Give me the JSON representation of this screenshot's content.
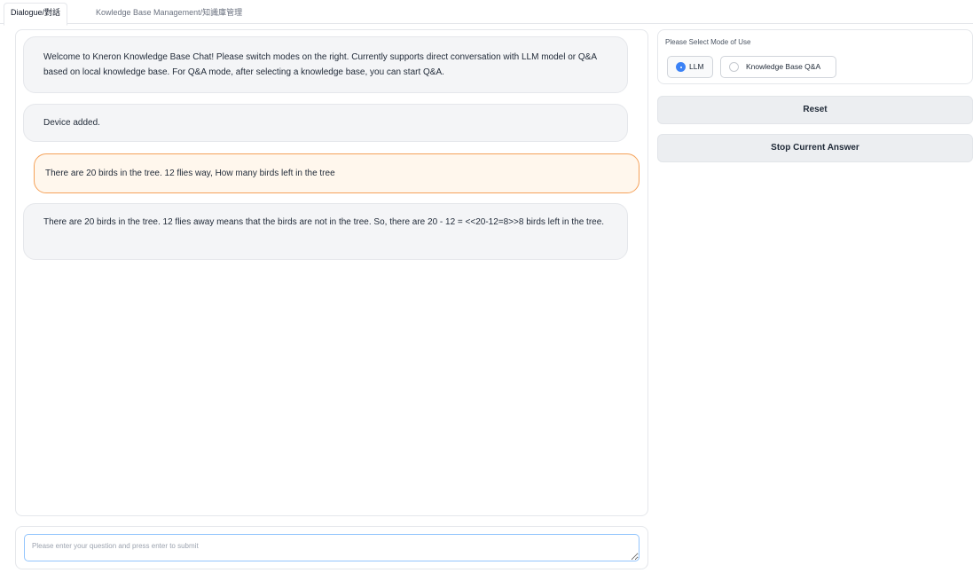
{
  "tabs": [
    {
      "label": "Dialogue/對話"
    },
    {
      "label": "Kowledge Base Management/知識庫管理"
    }
  ],
  "chat": {
    "messages": [
      {
        "role": "bot",
        "text": "Welcome to Kneron Knowledge Base Chat! Please switch modes on the right. Currently supports direct conversation with LLM model or Q&A based on local knowledge base. For Q&A mode, after selecting a knowledge base, you can start Q&A."
      },
      {
        "role": "bot",
        "text": "Device added."
      },
      {
        "role": "user",
        "text": "There are 20 birds in the tree. 12 flies way, How many birds left in the tree"
      },
      {
        "role": "bot",
        "text": "There are 20 birds in the tree. 12 flies away means that the birds are not in the tree. So, there are 20 - 12 = <<20-12=8>>8 birds left in the tree."
      }
    ]
  },
  "input": {
    "placeholder": "Please enter your question and press enter to submit"
  },
  "mode": {
    "label": "Please Select Mode of Use",
    "options": [
      {
        "label": "LLM",
        "selected": true
      },
      {
        "label": "Knowledge Base Q&A",
        "selected": false
      }
    ]
  },
  "buttons": {
    "reset": "Reset",
    "stop": "Stop Current Answer"
  },
  "colors": {
    "accent": "#3b82f6",
    "user_bubble_border": "#f5a25a",
    "user_bubble_bg": "#fff7ed",
    "bot_bubble_bg": "#f4f5f7"
  }
}
